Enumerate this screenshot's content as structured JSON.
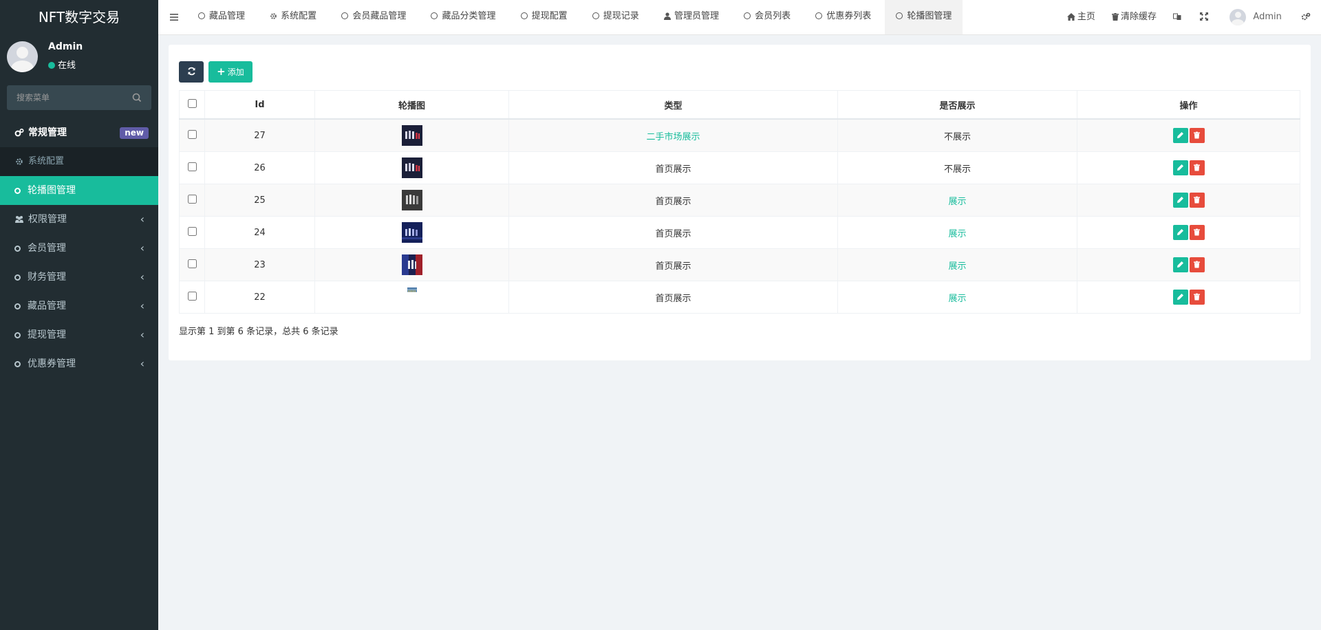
{
  "brand": "NFT数字交易",
  "user": {
    "name": "Admin",
    "status": "在线"
  },
  "search": {
    "placeholder": "搜索菜单"
  },
  "sidebar": {
    "items": [
      {
        "label": "常规管理",
        "badge": "new"
      },
      {
        "label": "系统配置"
      },
      {
        "label": "轮播图管理"
      },
      {
        "label": "权限管理"
      },
      {
        "label": "会员管理"
      },
      {
        "label": "财务管理"
      },
      {
        "label": "藏品管理"
      },
      {
        "label": "提现管理"
      },
      {
        "label": "优惠券管理"
      }
    ]
  },
  "topbar": {
    "tabs": [
      "藏品管理",
      "系统配置",
      "会员藏品管理",
      "藏品分类管理",
      "提现配置",
      "提现记录",
      "管理员管理",
      "会员列表",
      "优惠券列表",
      "轮播图管理"
    ],
    "home": "主页",
    "clear_cache": "清除缓存",
    "admin": "Admin"
  },
  "toolbar": {
    "add_label": "添加"
  },
  "table": {
    "headers": [
      "Id",
      "轮播图",
      "类型",
      "是否展示",
      "操作"
    ],
    "rows": [
      {
        "id": "27",
        "type": "二手市场展示",
        "show": "不展示"
      },
      {
        "id": "26",
        "type": "首页展示",
        "show": "不展示"
      },
      {
        "id": "25",
        "type": "首页展示",
        "show": "展示"
      },
      {
        "id": "24",
        "type": "首页展示",
        "show": "展示"
      },
      {
        "id": "23",
        "type": "首页展示",
        "show": "展示"
      },
      {
        "id": "22",
        "type": "首页展示",
        "show": "展示"
      }
    ]
  },
  "pager": {
    "text": "显示第 1 到第 6 条记录，总共 6 条记录"
  },
  "colors": {
    "sidebar_bg": "#222d32",
    "accent": "#18bc9c",
    "danger": "#e74c3c",
    "badge": "#605ca8",
    "dark_button": "#2c3e50"
  }
}
